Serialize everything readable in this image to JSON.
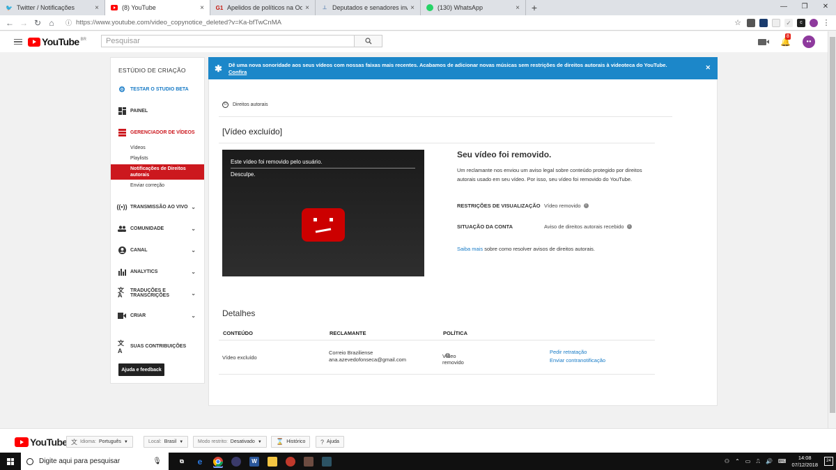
{
  "browser": {
    "tabs": [
      {
        "label": "Twitter / Notificações",
        "icon": "twitter-icon",
        "color": "#1da1f2"
      },
      {
        "label": "(8) YouTube",
        "icon": "youtube-icon",
        "color": "#ff0000"
      },
      {
        "label": "Apelidos de políticos na Odebrecht",
        "icon": "g1-icon",
        "color": "#c4170c"
      },
      {
        "label": "Deputados e senadores investigados",
        "icon": "chart-icon",
        "color": "#6b8fb8"
      },
      {
        "label": "(130) WhatsApp",
        "icon": "whatsapp-icon",
        "color": "#25d366"
      }
    ],
    "url": "https://www.youtube.com/video_copynotice_deleted?v=Ka-bfTwCnMA"
  },
  "header": {
    "logo": "YouTube",
    "region": "BR",
    "search_placeholder": "Pesquisar",
    "notification_count": "8"
  },
  "sidebar": {
    "title": "ESTÚDIO DE CRIAÇÃO",
    "beta": "TESTAR O STUDIO BETA",
    "dashboard": "PAINEL",
    "video_manager": "GERENCIADOR DE VÍDEOS",
    "sub": {
      "videos": "Vídeos",
      "playlists": "Playlists",
      "copyright_notices": "Notificações de Direitos autorais",
      "send_correction": "Enviar correção"
    },
    "sections": [
      {
        "label": "TRANSMISSÃO AO VIVO",
        "icon": "live-icon"
      },
      {
        "label": "COMUNIDADE",
        "icon": "community-icon"
      },
      {
        "label": "CANAL",
        "icon": "channel-icon"
      },
      {
        "label": "ANALYTICS",
        "icon": "analytics-icon"
      },
      {
        "label": "TRADUÇÕES E TRANSCRIÇÕES",
        "icon": "translate-icon"
      },
      {
        "label": "CRIAR",
        "icon": "create-icon"
      }
    ],
    "contributions": "SUAS CONTRIBUIÇÕES",
    "help": "Ajuda e feedback"
  },
  "banner": {
    "text": "Dê uma nova sonoridade aos seus vídeos com nossas faixas mais recentes. Acabamos de adicionar novas músicas sem restrições de direitos autorais à videoteca do YouTube.",
    "link": "Confira"
  },
  "main": {
    "breadcrumb": "Direitos autorais",
    "video_title": "[Vídeo excluído]",
    "player": {
      "line1": "Este vídeo foi removido pelo usuário.",
      "line2": "Desculpe."
    },
    "removed_heading": "Seu vídeo foi removido.",
    "removed_desc": "Um reclamante nos enviou um aviso legal sobre conteúdo protegido por direitos autorais usado em seu vídeo. Por isso, seu vídeo foi removido do YouTube.",
    "restrictions_label": "RESTRIÇÕES DE VISUALIZAÇÃO",
    "restrictions_value": "Vídeo removido",
    "status_label": "SITUAÇÃO DA CONTA",
    "status_value": "Aviso de direitos autorais recebido",
    "learn_link": "Saiba mais",
    "learn_text": " sobre como resolver avisos de direitos autorais.",
    "details_title": "Detalhes",
    "table": {
      "headers": [
        "CONTEÚDO",
        "RECLAMANTE",
        "POLÍTICA"
      ],
      "row": {
        "content": "Vídeo excluído",
        "claimant_name": "Correio Braziliense",
        "claimant_email": "ana.azevedofonseca@gmail.com",
        "policy": "Vídeo removido",
        "action1": "Pedir retratação",
        "action2": "Enviar contranotificação"
      }
    }
  },
  "footer": {
    "logo": "YouTube",
    "language_label": "Idioma:",
    "language_value": "Português",
    "location_label": "Local:",
    "location_value": "Brasil",
    "restricted_label": "Modo restrito:",
    "restricted_value": "Desativado",
    "history": "Histórico",
    "help": "Ajuda"
  },
  "taskbar": {
    "search_placeholder": "Digite aqui para pesquisar",
    "time": "14:08",
    "date": "07/12/2018",
    "notifications": "24"
  }
}
